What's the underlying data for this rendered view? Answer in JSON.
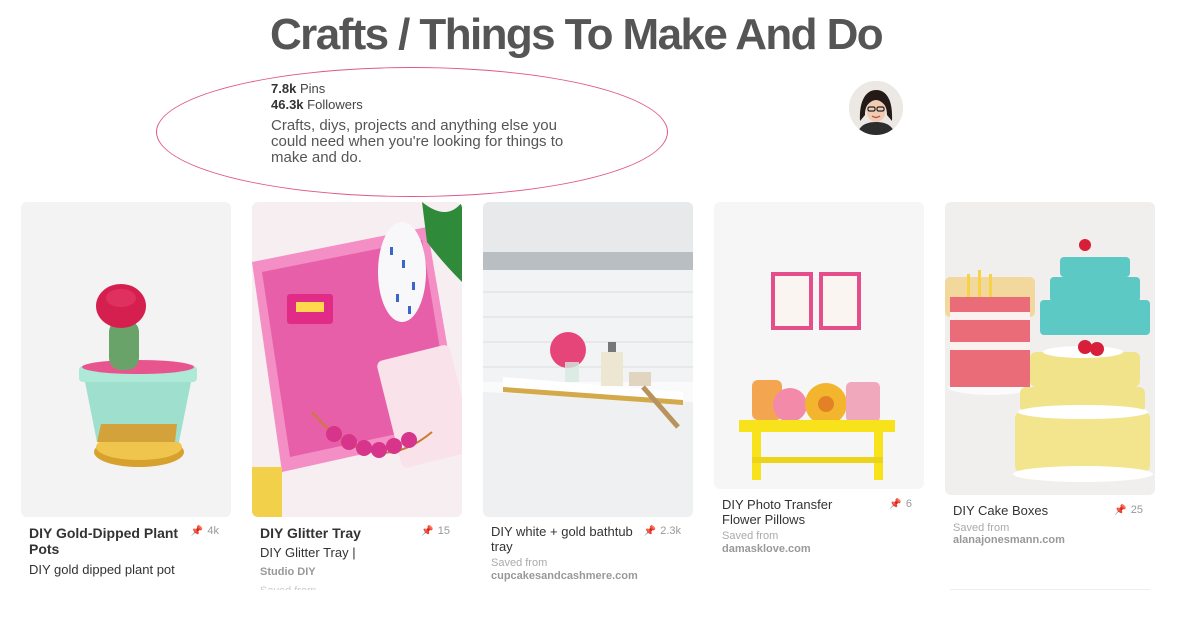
{
  "board": {
    "title": "Crafts / Things To Make And Do",
    "pins_count": "7.8k",
    "pins_label": "Pins",
    "followers_count": "46.3k",
    "followers_label": "Followers",
    "description": "Crafts, diys, projects and anything else you could need when you're looking for things to make and do."
  },
  "annotation_color": "#e0578d",
  "pins": [
    {
      "title": "DIY Gold-Dipped Plant Pots",
      "repin_icon": "pin-icon",
      "count": "4k",
      "description": "DIY gold dipped plant pot"
    },
    {
      "title": "DIY Glitter Tray",
      "repin_icon": "pin-icon",
      "count": "15",
      "description": "DIY Glitter Tray |",
      "subtitle": "Studio DIY",
      "faded": "Saved from"
    },
    {
      "title": "DIY white + gold bathtub tray",
      "repin_icon": "pin-icon",
      "count": "2.3k",
      "saved_from_label": "Saved from",
      "source": "cupcakesandcashmere.com"
    },
    {
      "title": "DIY Photo Transfer Flower Pillows",
      "repin_icon": "pin-icon",
      "count": "6",
      "saved_from_label": "Saved from",
      "source": "damasklove.com"
    },
    {
      "title": "DIY Cake Boxes",
      "repin_icon": "pin-icon",
      "count": "25",
      "saved_from_label": "Saved from",
      "source": "alanajonesmann.com"
    }
  ]
}
